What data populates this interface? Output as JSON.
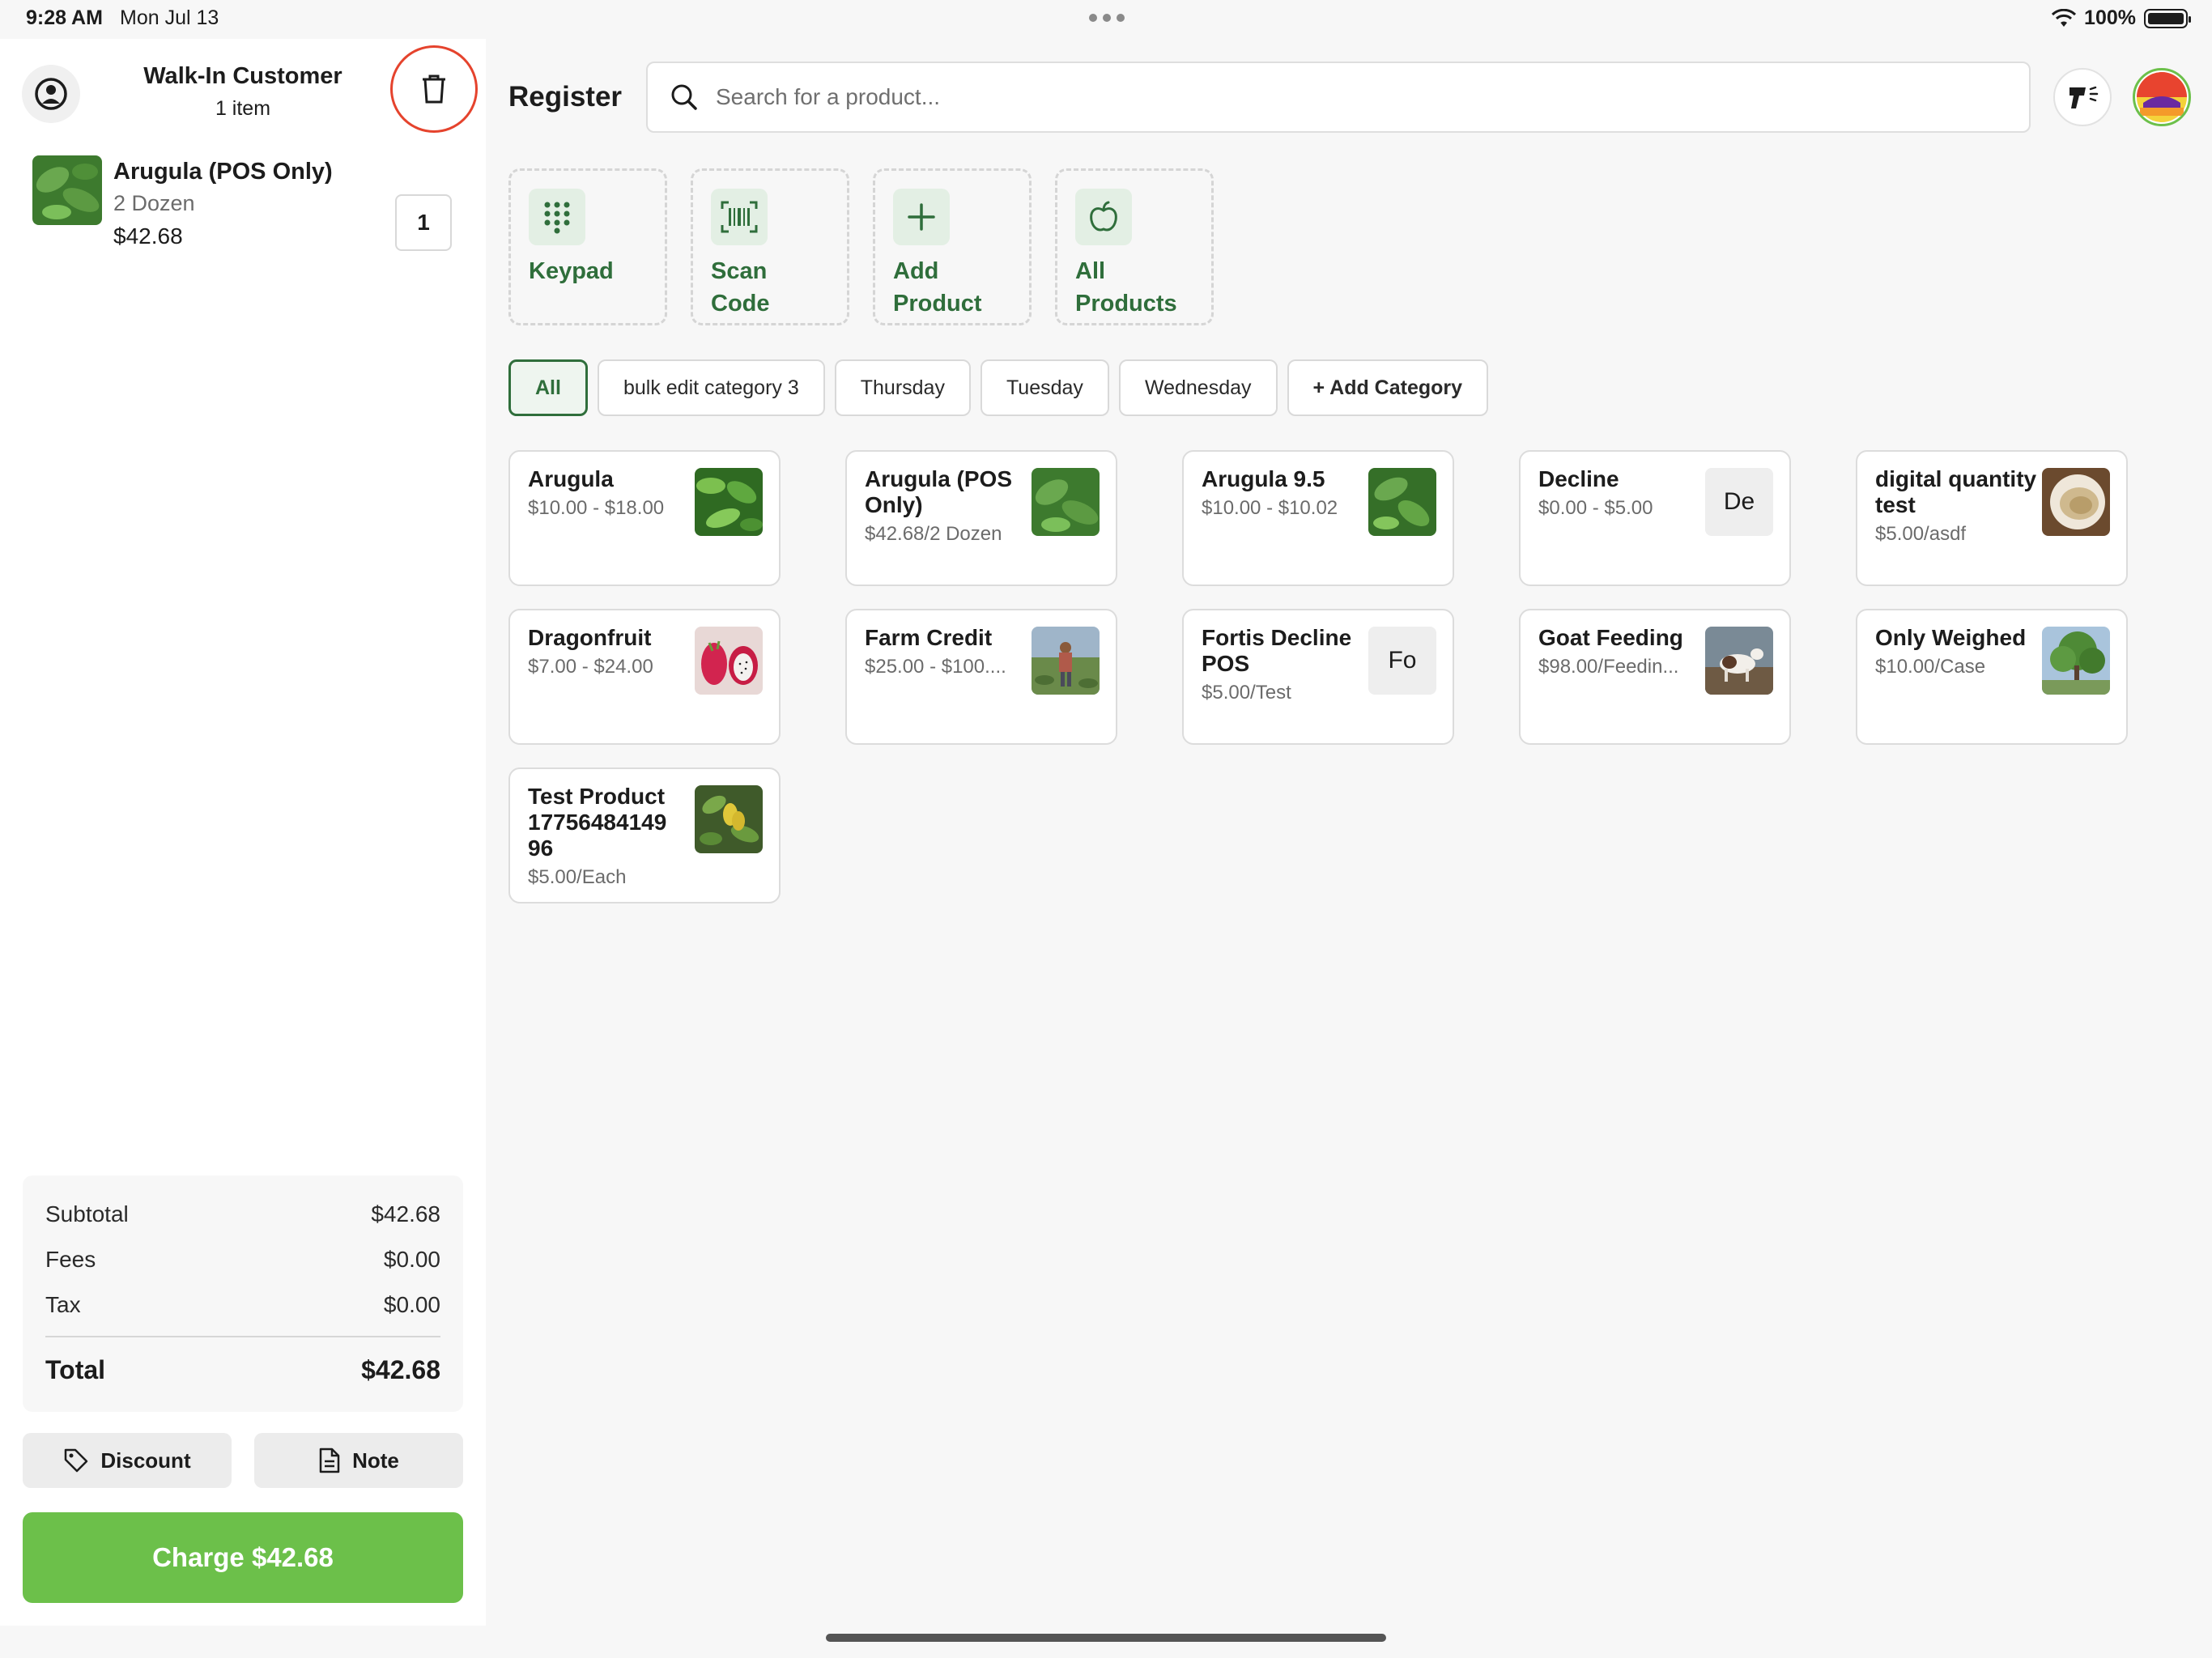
{
  "status": {
    "time": "9:28 AM",
    "date": "Mon Jul 13",
    "battery": "100%"
  },
  "cart": {
    "customer_name": "Walk-In Customer",
    "item_count": "1 item",
    "items": [
      {
        "name": "Arugula (POS Only)",
        "unit": "2 Dozen",
        "price": "$42.68",
        "qty": "1"
      }
    ],
    "summary": {
      "subtotal_label": "Subtotal",
      "subtotal": "$42.68",
      "fees_label": "Fees",
      "fees": "$0.00",
      "tax_label": "Tax",
      "tax": "$0.00",
      "total_label": "Total",
      "total": "$42.68"
    },
    "discount_label": "Discount",
    "note_label": "Note",
    "charge_label": "Charge $42.68"
  },
  "header": {
    "title": "Register",
    "search_placeholder": "Search for a product..."
  },
  "tiles": [
    {
      "label": "Keypad",
      "icon": "keypad-icon"
    },
    {
      "label": "Scan Code",
      "icon": "barcode-icon"
    },
    {
      "label": "Add Product",
      "icon": "plus-icon"
    },
    {
      "label": "All Products",
      "icon": "apple-icon"
    }
  ],
  "categories": [
    "All",
    "bulk edit category 3",
    "Thursday",
    "Tuesday",
    "Wednesday",
    "+ Add Category"
  ],
  "active_category": "All",
  "products": [
    {
      "name": "Arugula",
      "price": "$10.00 - $18.00",
      "thumb": "leaf"
    },
    {
      "name": "Arugula (POS Only)",
      "price": "$42.68/2 Dozen",
      "thumb": "leaf"
    },
    {
      "name": "Arugula 9.5",
      "price": "$10.00 - $10.02",
      "thumb": "leaf"
    },
    {
      "name": "Decline",
      "price": "$0.00 - $5.00",
      "initials": "De"
    },
    {
      "name": "digital quantity test",
      "price": "$5.00/asdf",
      "thumb": "grain"
    },
    {
      "name": "Dragonfruit",
      "price": "$7.00 - $24.00",
      "thumb": "dragonfruit"
    },
    {
      "name": "Farm Credit",
      "price": "$25.00 - $100....",
      "thumb": "farm"
    },
    {
      "name": "Fortis Decline POS",
      "price": "$5.00/Test",
      "initials": "Fo"
    },
    {
      "name": "Goat Feeding",
      "price": "$98.00/Feedin...",
      "thumb": "goat"
    },
    {
      "name": "Only Weighed",
      "price": "$10.00/Case",
      "thumb": "tree"
    },
    {
      "name": "Test Product 17756484149 96",
      "price": "$5.00/Each",
      "thumb": "fruit"
    }
  ],
  "colors": {
    "accent": "#2f6e3b",
    "charge": "#6cc04a",
    "danger": "#e5432d"
  }
}
